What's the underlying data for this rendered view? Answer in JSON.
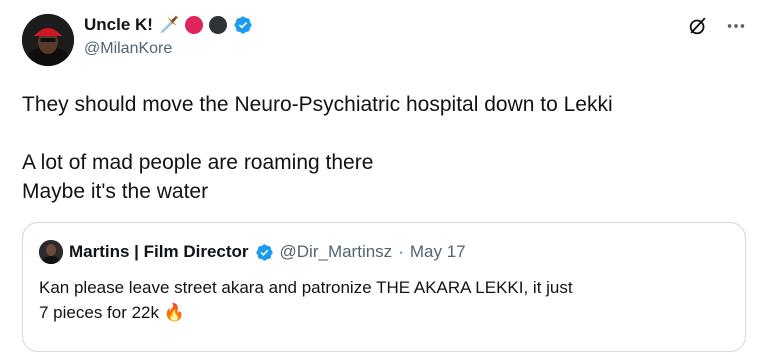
{
  "author": {
    "display_name": "Uncle K!",
    "handle": "@MilanKore",
    "name_emoji": "🗡️",
    "accent_colors": [
      "#e0245e",
      "#2f3336"
    ]
  },
  "icons": {
    "verified": "verified-badge-icon",
    "grok": "grok-icon",
    "more": "more-icon"
  },
  "tweet": {
    "line1": "They should move the Neuro-Psychiatric hospital down to Lekki",
    "line2": "A lot of mad people are roaming there",
    "line3": "Maybe it's the water"
  },
  "quoted": {
    "display_name": "Martins | Film Director",
    "handle": "@Dir_Martinsz",
    "separator": "·",
    "date": "May 17",
    "line1": "Kan please leave street akara and patronize THE AKARA LEKKI, it just",
    "line2": "7 pieces for 22k",
    "emoji": "🔥"
  },
  "colors": {
    "verified_blue": "#1d9bf0",
    "text": "#0f1419",
    "secondary": "#536471",
    "border": "#cfd9de"
  }
}
